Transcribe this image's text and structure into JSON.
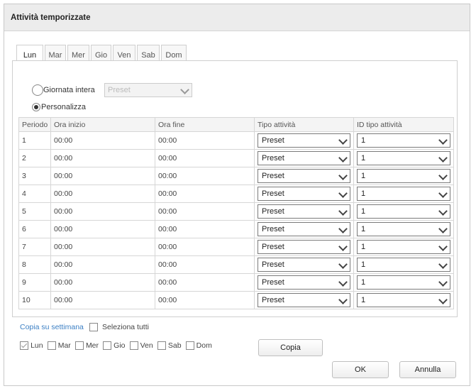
{
  "dialog": {
    "title": "Attività temporizzate",
    "tabs": [
      {
        "label": "Lun",
        "active": true
      },
      {
        "label": "Mar",
        "active": false
      },
      {
        "label": "Mer",
        "active": false
      },
      {
        "label": "Gio",
        "active": false
      },
      {
        "label": "Ven",
        "active": false
      },
      {
        "label": "Sab",
        "active": false
      },
      {
        "label": "Dom",
        "active": false
      }
    ],
    "mode": {
      "all_day_label": "Giornata intera",
      "all_day_selected": false,
      "all_day_select_value": "Preset",
      "custom_label": "Personalizza",
      "custom_selected": true
    },
    "table": {
      "headers": {
        "period": "Periodo",
        "start": "Ora inizio",
        "end": "Ora fine",
        "type": "Tipo attività",
        "type_id": "ID tipo attività"
      },
      "rows": [
        {
          "period": "1",
          "start": "00:00",
          "end": "00:00",
          "type": "Preset",
          "type_id": "1"
        },
        {
          "period": "2",
          "start": "00:00",
          "end": "00:00",
          "type": "Preset",
          "type_id": "1"
        },
        {
          "period": "3",
          "start": "00:00",
          "end": "00:00",
          "type": "Preset",
          "type_id": "1"
        },
        {
          "period": "4",
          "start": "00:00",
          "end": "00:00",
          "type": "Preset",
          "type_id": "1"
        },
        {
          "period": "5",
          "start": "00:00",
          "end": "00:00",
          "type": "Preset",
          "type_id": "1"
        },
        {
          "period": "6",
          "start": "00:00",
          "end": "00:00",
          "type": "Preset",
          "type_id": "1"
        },
        {
          "period": "7",
          "start": "00:00",
          "end": "00:00",
          "type": "Preset",
          "type_id": "1"
        },
        {
          "period": "8",
          "start": "00:00",
          "end": "00:00",
          "type": "Preset",
          "type_id": "1"
        },
        {
          "period": "9",
          "start": "00:00",
          "end": "00:00",
          "type": "Preset",
          "type_id": "1"
        },
        {
          "period": "10",
          "start": "00:00",
          "end": "00:00",
          "type": "Preset",
          "type_id": "1"
        }
      ]
    },
    "copy": {
      "link_label": "Copia su settimana",
      "select_all_label": "Seleziona tutti",
      "select_all_checked": false,
      "days": [
        {
          "label": "Lun",
          "checked": true
        },
        {
          "label": "Mar",
          "checked": false
        },
        {
          "label": "Mer",
          "checked": false
        },
        {
          "label": "Gio",
          "checked": false
        },
        {
          "label": "Ven",
          "checked": false
        },
        {
          "label": "Sab",
          "checked": false
        },
        {
          "label": "Dom",
          "checked": false
        }
      ],
      "copy_button": "Copia"
    },
    "ok_button": "OK",
    "cancel_button": "Annulla"
  }
}
